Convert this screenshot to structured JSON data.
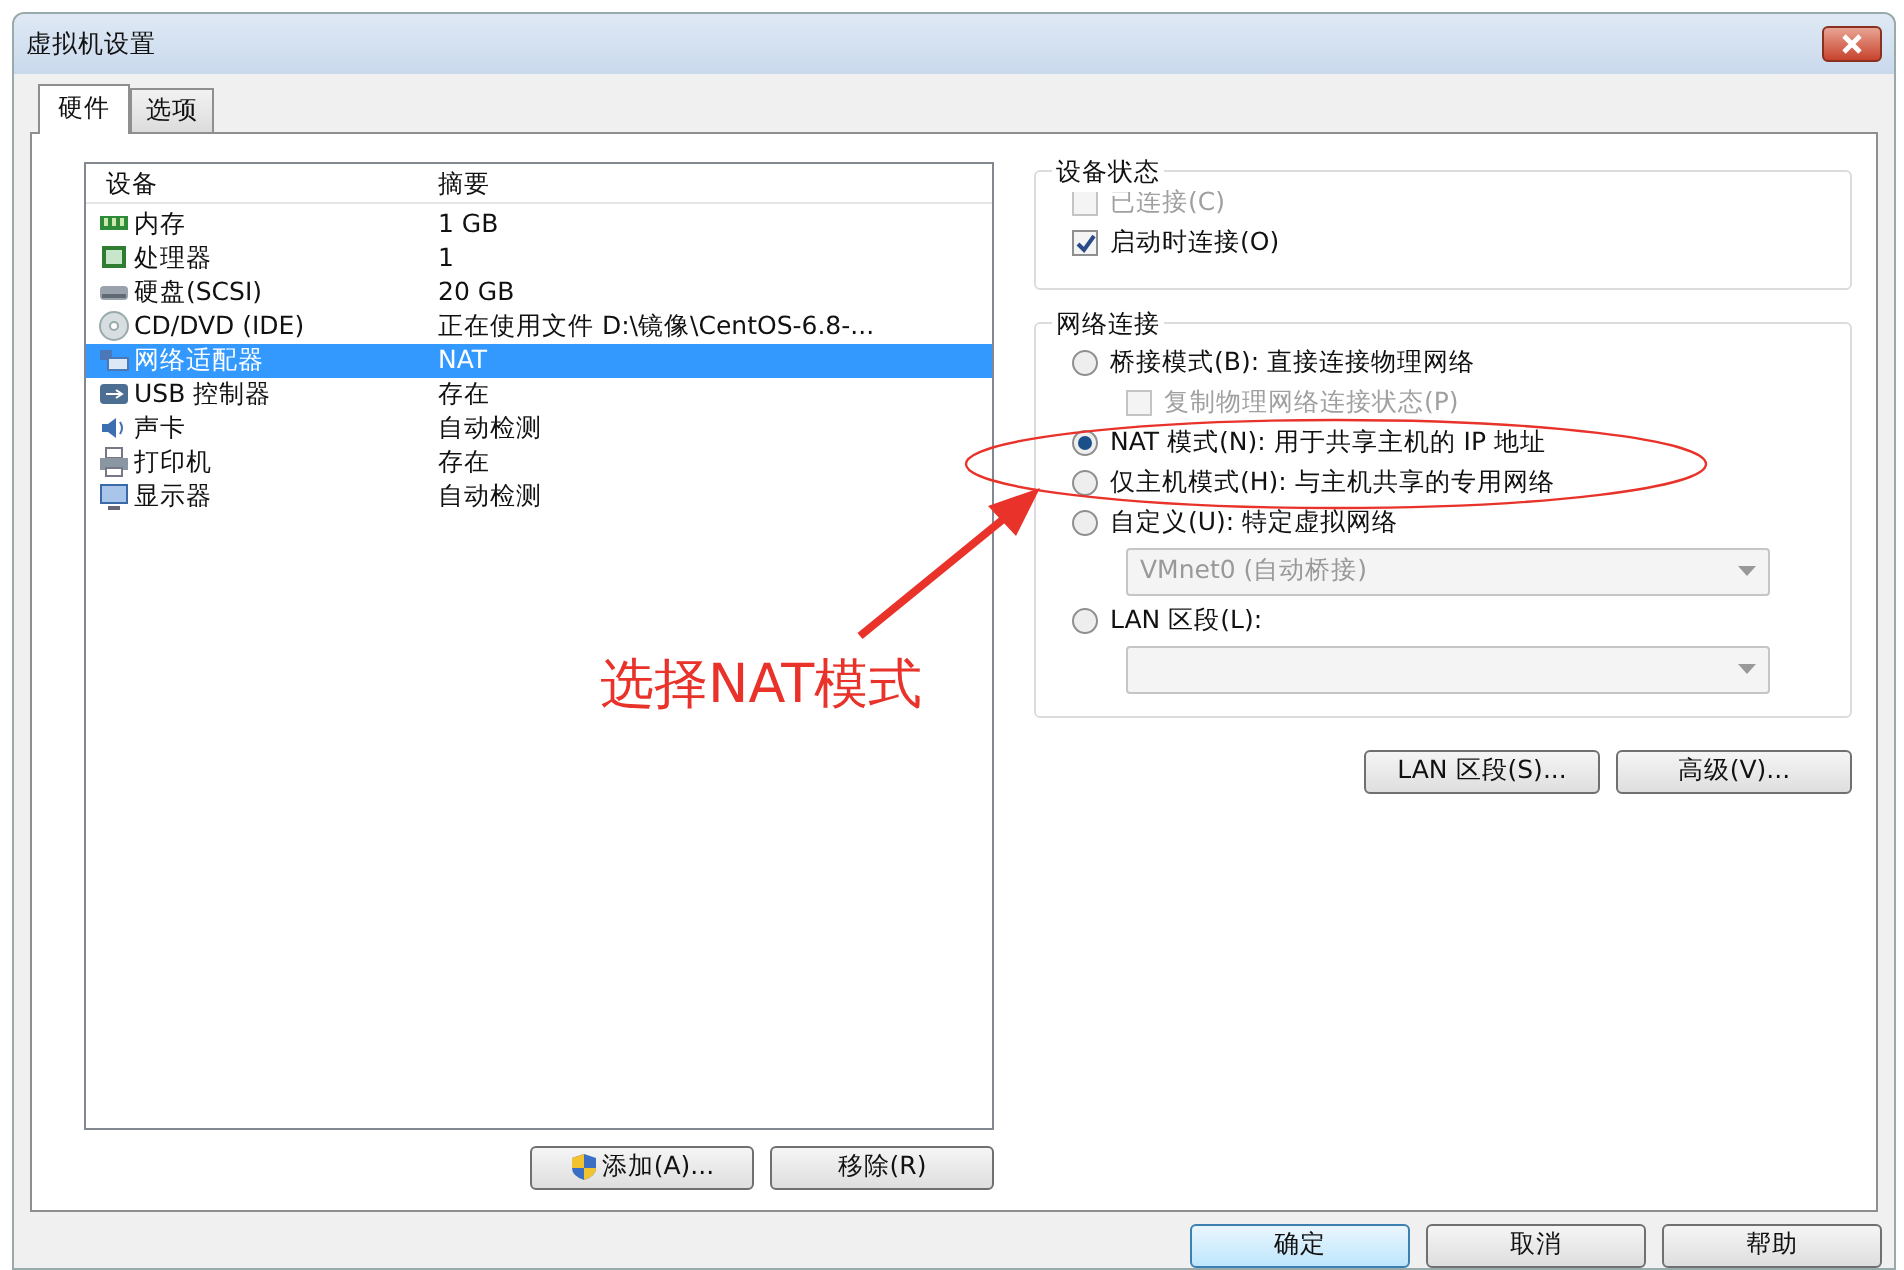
{
  "window": {
    "title": "虚拟机设置"
  },
  "tabs": [
    {
      "label": "硬件",
      "selected": true
    },
    {
      "label": "选项",
      "selected": false
    }
  ],
  "devices": {
    "columns": [
      "设备",
      "摘要"
    ],
    "rows": [
      {
        "kind": "memory",
        "name": "内存",
        "summary": "1 GB",
        "selected": false
      },
      {
        "kind": "cpu",
        "name": "处理器",
        "summary": "1",
        "selected": false
      },
      {
        "kind": "disk",
        "name": "硬盘(SCSI)",
        "summary": "20 GB",
        "selected": false
      },
      {
        "kind": "cdrom",
        "name": "CD/DVD (IDE)",
        "summary": "正在使用文件 D:\\镜像\\CentOS-6.8-...",
        "selected": false
      },
      {
        "kind": "network",
        "name": "网络适配器",
        "summary": "NAT",
        "selected": true
      },
      {
        "kind": "usb",
        "name": "USB 控制器",
        "summary": "存在",
        "selected": false
      },
      {
        "kind": "sound",
        "name": "声卡",
        "summary": "自动检测",
        "selected": false
      },
      {
        "kind": "printer",
        "name": "打印机",
        "summary": "存在",
        "selected": false
      },
      {
        "kind": "display",
        "name": "显示器",
        "summary": "自动检测",
        "selected": false
      }
    ]
  },
  "list_buttons": [
    {
      "label": "添加(A)...",
      "shield": true
    },
    {
      "label": "移除(R)",
      "shield": false
    }
  ],
  "device_status": {
    "title": "设备状态",
    "items": [
      {
        "label": "已连接(C)",
        "checked": false,
        "disabled": true
      },
      {
        "label": "启动时连接(O)",
        "checked": true,
        "disabled": false
      }
    ]
  },
  "network_connection": {
    "title": "网络连接",
    "items": [
      {
        "kind": "radio",
        "label": "桥接模式(B): 直接连接物理网络",
        "selected": false
      },
      {
        "kind": "checkbox",
        "label": "复制物理网络连接状态(P)",
        "checked": false,
        "disabled": true
      },
      {
        "kind": "radio",
        "label": "NAT 模式(N): 用于共享主机的 IP 地址",
        "selected": true
      },
      {
        "kind": "radio",
        "label": "仅主机模式(H): 与主机共享的专用网络",
        "selected": false
      },
      {
        "kind": "radio",
        "label": "自定义(U): 特定虚拟网络",
        "selected": false
      },
      {
        "kind": "select",
        "value": "VMnet0 (自动桥接)",
        "disabled": true
      },
      {
        "kind": "radio",
        "label": "LAN 区段(L):",
        "selected": false
      },
      {
        "kind": "select",
        "disabled": true
      }
    ]
  },
  "network_buttons": [
    "LAN 区段(S)...",
    "高级(V)..."
  ],
  "dialog_buttons": [
    {
      "label": "确定",
      "default": true
    },
    {
      "label": "取消",
      "default": false
    },
    {
      "label": "帮助",
      "default": false
    }
  ],
  "annotation": {
    "text": "选择NAT模式"
  }
}
